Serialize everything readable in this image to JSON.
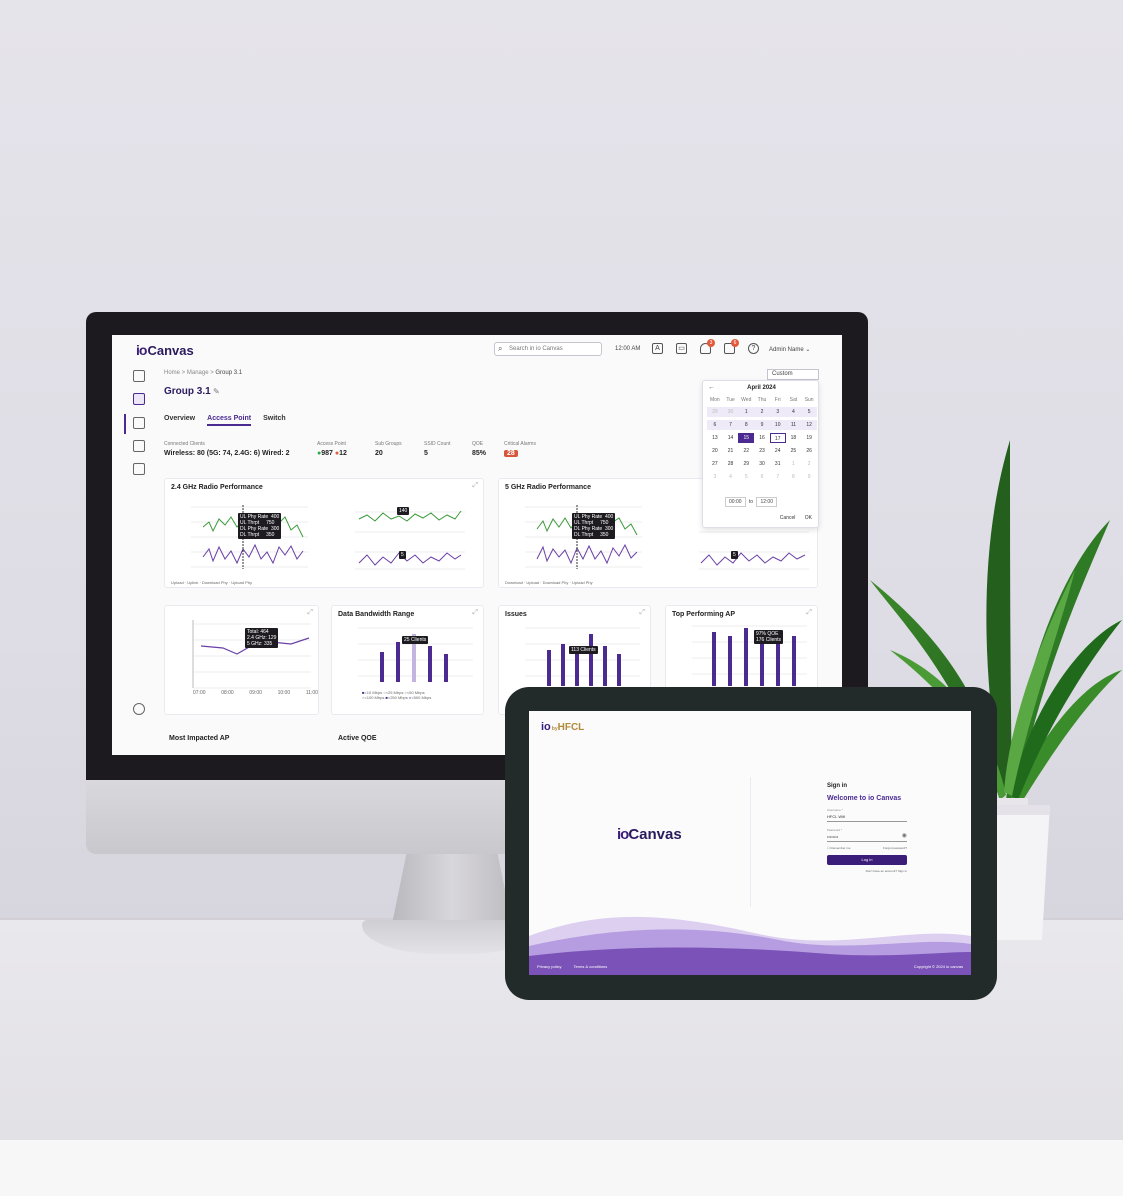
{
  "app": {
    "logo": "Canvas",
    "logo_mark": "io",
    "search_placeholder": "Search in io Canvas",
    "time": "12:00 AM",
    "notif_badge_1": "3",
    "notif_badge_2": "6",
    "admin_name": "Admin Name"
  },
  "breadcrumb": {
    "home": "Home",
    "manage": "Manage",
    "current": "Group 3.1"
  },
  "page": {
    "title": "Group 3.1"
  },
  "tabs": [
    "Overview",
    "Access Point",
    "Switch"
  ],
  "date_range": {
    "selected": "Custom"
  },
  "stats": {
    "connected_clients_label": "Connected Clients",
    "connected_clients_value": "Wireless: 80 (5G: 74, 2.4G: 6)  Wired: 2",
    "access_point_label": "Access Point",
    "access_point_up": "987",
    "access_point_down": "12",
    "sub_groups_label": "Sub Groups",
    "sub_groups_value": "20",
    "ssid_count_label": "SSID Count",
    "ssid_count_value": "5",
    "qoe_label": "QOE",
    "qoe_value": "85%",
    "critical_alarms_label": "Critical Alarms",
    "critical_alarms_value": "28"
  },
  "calendar": {
    "month": "April  2024",
    "weekdays": [
      "Mon",
      "Tue",
      "Wed",
      "Thu",
      "Fri",
      "Sat",
      "Sun"
    ],
    "days": [
      [
        "29",
        "30",
        "1",
        "2",
        "3",
        "4",
        "5"
      ],
      [
        "6",
        "7",
        "8",
        "9",
        "10",
        "11",
        "12"
      ],
      [
        "13",
        "14",
        "15",
        "16",
        "17",
        "18",
        "19"
      ],
      [
        "20",
        "21",
        "22",
        "23",
        "24",
        "25",
        "26"
      ],
      [
        "27",
        "28",
        "29",
        "30",
        "31",
        "1",
        "2"
      ],
      [
        "3",
        "4",
        "5",
        "6",
        "7",
        "8",
        "9"
      ]
    ],
    "selected_day": "15",
    "today_day": "17",
    "time_from": "00:00",
    "time_to_label": "to",
    "time_to": "12:00",
    "cancel": "Cancel",
    "ok": "OK"
  },
  "panels": {
    "radio_24": {
      "title": "2.4 GHz Radio Performance",
      "tooltip": "UL Phy Rate  400\nUL Thrpt     750\nDL Phy Rate  300\nDL Thrpt     350",
      "legend": [
        "Upload",
        "Uplink",
        "Download Phy",
        "Upload Phy"
      ],
      "badge_a": "140",
      "badge_b": "5"
    },
    "radio_5": {
      "title": "5 GHz Radio Performance",
      "tooltip": "UL Phy Rate  400\nUL Thrpt     750\nDL Phy Rate  300\nDL Thrpt     350",
      "legend": [
        "Download",
        "Upload",
        "Download Phy",
        "Upload Phy"
      ],
      "badge_b": "5"
    },
    "clients_trend": {
      "tooltip": "Total: 464\n2.4 GHz: 129\n5 GHz: 335",
      "x_ticks": [
        "07:00",
        "08:00",
        "09:00",
        "10:00",
        "11:00"
      ]
    },
    "bandwidth": {
      "title": "Data Bandwidth Range",
      "tooltip": "25 Clients",
      "legend": [
        "<10 Mbps",
        "<25 Mbps",
        "<50 Mbps",
        "<100 Mbps",
        "<250 Mbps",
        "<500 Mbps"
      ]
    },
    "issues": {
      "title": "Issues",
      "tooltip": "113 Clients"
    },
    "top_ap": {
      "title": "Top Performing AP",
      "tooltip": "97% QOE\n176 Clients"
    },
    "most_impacted": {
      "title": "Most Impacted AP"
    },
    "active_qoe": {
      "title": "Active QOE"
    }
  },
  "tablet": {
    "logo": "io",
    "by": "by",
    "vendor": "HFCL",
    "brand_mark": "io",
    "brand": "Canvas",
    "sign_in": "Sign in",
    "welcome": "Welcome to io Canvas",
    "username_label": "Username *",
    "username_value": "HFCL Wifi",
    "password_label": "Password *",
    "password_value": "••••••••",
    "remember": "Remember me",
    "forgot": "Forgot password?",
    "login": "Log in",
    "signup": "Don't have an account?  Sign in",
    "privacy": "Privacy policy",
    "terms": "Terms & conditions",
    "copyright": "Copyright © 2024 io canvas"
  },
  "colors": {
    "brand": "#4b2a91",
    "brand_dark": "#2b1a5c",
    "alarm": "#d7553a",
    "up": "#2fa84f",
    "wave_light": "#c9b6e6",
    "wave_dark": "#7b52b8"
  }
}
